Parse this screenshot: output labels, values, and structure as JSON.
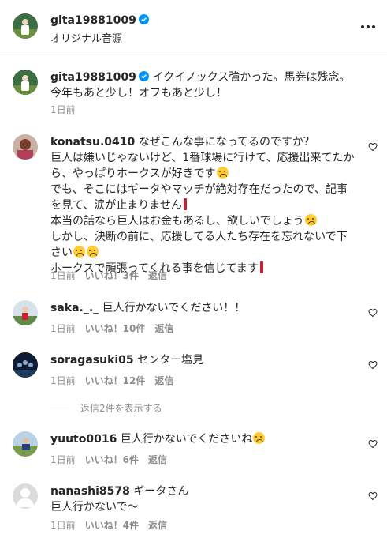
{
  "header": {
    "username": "gita19881009",
    "subtitle": "オリジナル音源"
  },
  "caption": {
    "username": "gita19881009",
    "line1": "イクイノックス強かった。馬券は残念。",
    "line2": "今年もあと少し！オフもあと少し！",
    "time": "1日前"
  },
  "comments": [
    {
      "username": "konatsu.0410",
      "lines": [
        "なぜこんな事になってるのですか？",
        "巨人は嫌いじゃないけど、1番球場に行けて、応援出来てたか",
        "ら、やっぱりホークスが好きです",
        "でも、そこにはギータやマッチが絶対存在だったので、記事",
        "を見て、涙が止まりません",
        "本当の話なら巨人はお金もあるし、欲しいでしょう",
        "しかし、決断の前に、応援してる人たち存在を忘れないで下",
        "さい",
        "ホークスで頑張ってくれる事を信じてます"
      ],
      "time": "1日前",
      "likes": "いいね！3件",
      "reply": "返信"
    },
    {
      "username": "saka._._",
      "text": "巨人行かないでください！！",
      "time": "1日前",
      "likes": "いいね！10件",
      "reply": "返信"
    },
    {
      "username": "soragasuki05",
      "text": "センター塩見",
      "time": "1日前",
      "likes": "いいね！12件",
      "reply": "返信",
      "view_replies": "返信2件を表示する"
    },
    {
      "username": "yuuto0016",
      "text": "巨人行かないでくださいね",
      "time": "1日前",
      "likes": "いいね！6件",
      "reply": "返信"
    },
    {
      "username": "nanashi8578",
      "text": "ギータさん",
      "text2": "巨人行かないで〜",
      "time": "1日前",
      "likes": "いいね！4件",
      "reply": "返信"
    }
  ],
  "colors": {
    "text": "#262626",
    "muted": "#8e8e8e",
    "verified": "#0095f6"
  },
  "icons": [
    "verified-badge-icon",
    "more-options-icon",
    "heart-icon"
  ]
}
